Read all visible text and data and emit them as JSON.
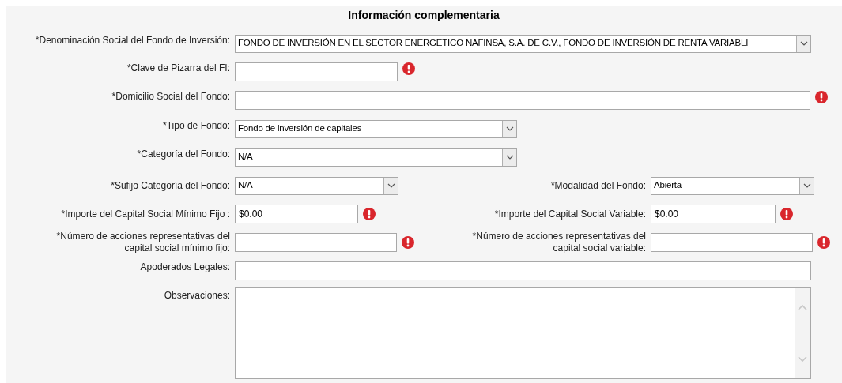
{
  "section_title": "Información complementaria",
  "rows": [
    {
      "fields": [
        {
          "label": "*Denominación Social del Fondo de Inversión:",
          "kind": "select",
          "value": "FONDO DE INVERSIÓN EN EL SECTOR ENERGETICO NAFINSA, S.A. DE C.V., FONDO DE INVERSIÓN DE RENTA VARIABLI",
          "error": false
        }
      ]
    },
    {
      "fields": [
        {
          "label": "*Clave de Pizarra del FI:",
          "kind": "text",
          "error": true
        }
      ]
    },
    {
      "fields": [
        {
          "label": "*Domicilio Social del Fondo:",
          "kind": "text",
          "error": true
        }
      ]
    },
    {
      "fields": [
        {
          "label": "*Tipo de Fondo:",
          "kind": "select",
          "value": "Fondo de inversión de capitales",
          "error": false
        }
      ]
    },
    {
      "fields": [
        {
          "label": "*Categoría del Fondo:",
          "kind": "select",
          "value": "N/A",
          "error": false
        }
      ]
    },
    {
      "fields": [
        {
          "label": "*Sufijo Categoría del Fondo:",
          "kind": "select",
          "value": "N/A",
          "error": false
        },
        {
          "label": "*Modalidad del Fondo:",
          "kind": "select",
          "value": "Abierta",
          "error": false
        }
      ]
    },
    {
      "fields": [
        {
          "label": "*Importe del Capital Social Mínimo Fijo :",
          "kind": "text",
          "value": "$0.00",
          "error": true
        },
        {
          "label": "*Importe del Capital Social Variable:",
          "kind": "text",
          "value": "$0.00",
          "error": true
        }
      ]
    },
    {
      "fields": [
        {
          "label": "*Número de acciones representativas del capital social mínimo fijo:",
          "kind": "text",
          "error": true
        },
        {
          "label": "*Número de acciones representativas del capital social variable:",
          "kind": "text",
          "error": true
        }
      ]
    },
    {
      "fields": [
        {
          "label": "Apoderados Legales:",
          "kind": "text",
          "error": false
        }
      ]
    },
    {
      "fields": [
        {
          "label": "Observaciones:",
          "kind": "textarea",
          "error": false
        }
      ]
    }
  ]
}
